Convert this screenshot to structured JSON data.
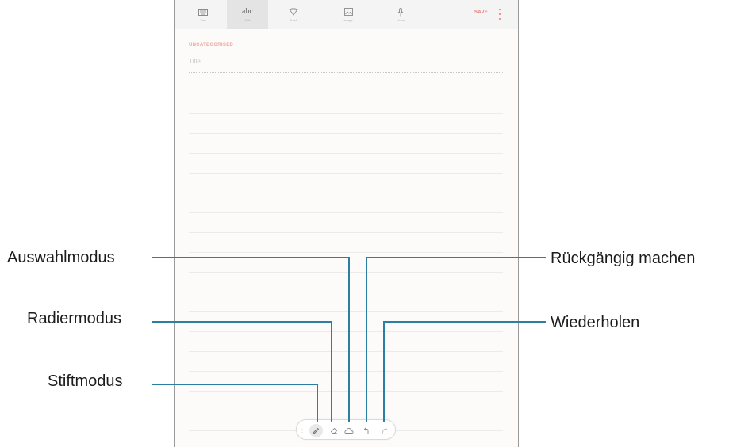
{
  "toolbar": {
    "tools": [
      {
        "icon": "keyboard-icon",
        "label": "Text",
        "active": false
      },
      {
        "icon": "handwriting-abc-icon",
        "label": "abc",
        "sublabel": "Stift",
        "active": true
      },
      {
        "icon": "brush-icon",
        "label": "Brush",
        "active": false
      },
      {
        "icon": "image-icon",
        "label": "Image",
        "active": false
      },
      {
        "icon": "microphone-icon",
        "label": "Voice",
        "active": false
      }
    ],
    "save_label": "SAVE",
    "accent_color": "#e9786a"
  },
  "note": {
    "category_label": "UNCATEGORISED",
    "title_placeholder": "Title"
  },
  "penbar": {
    "tools": [
      "handle-icon",
      "pen-icon",
      "eraser-icon",
      "selection-icon",
      "undo-icon",
      "redo-icon"
    ],
    "active": "pen-icon"
  },
  "callouts": {
    "auswahlmodus": "Auswahlmodus",
    "radiermodus": "Radiermodus",
    "stiftmodus": "Stiftmodus",
    "rueckgaengig": "Rückgängig machen",
    "wiederholen": "Wiederholen",
    "line_color": "#2b7fa3"
  }
}
